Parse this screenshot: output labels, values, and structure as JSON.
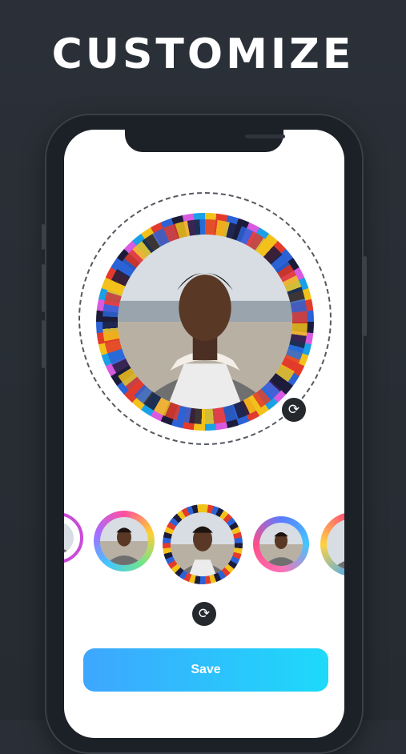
{
  "headline": "CUSTOMIZE",
  "editor": {
    "rotate_icon": "rotate-icon",
    "selected_frame": "tribal-pattern"
  },
  "frames": [
    {
      "name": "pink-ring"
    },
    {
      "name": "rainbow-gradient-ring"
    },
    {
      "name": "tribal-pattern",
      "selected": true
    },
    {
      "name": "blue-pink-gradient-ring"
    },
    {
      "name": "colorful-ring"
    }
  ],
  "save_button": {
    "label": "Save"
  },
  "colors": {
    "background": "#2a2f37",
    "save_gradient_start": "#3ea6ff",
    "save_gradient_end": "#1ddaf9",
    "rotate_button": "#25282d"
  }
}
